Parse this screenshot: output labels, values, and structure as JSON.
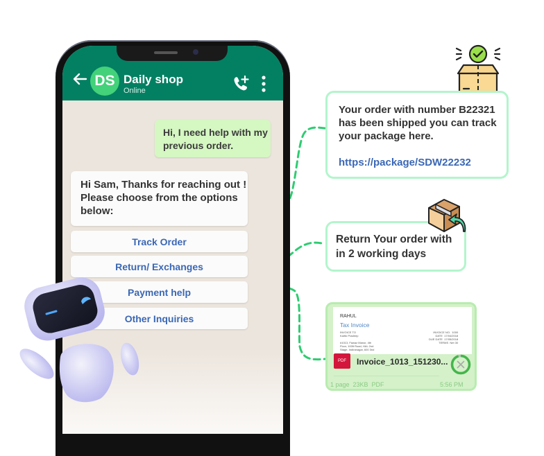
{
  "chat": {
    "contact_initials": "DS",
    "contact_name": "Daily shop",
    "contact_status": "Online",
    "icons": {
      "back": "arrow-left-icon",
      "call": "add-call-icon",
      "menu": "more-vertical-icon"
    },
    "messages": [
      {
        "direction": "outgoing",
        "text": "Hi, I need help with my previous order."
      },
      {
        "direction": "incoming",
        "text": "Hi Sam, Thanks for reaching out ! Please choose from the options below:"
      }
    ],
    "options": [
      {
        "label": "Track Order"
      },
      {
        "label": "Return/ Exchanges"
      },
      {
        "label": "Payment help"
      },
      {
        "label": "Other Inquiries"
      }
    ]
  },
  "responses": {
    "track": {
      "icon": "package-shipped-icon",
      "text": "Your order with number B22321 has been shipped you can track your package here.",
      "link": "https://package/SDW22232"
    },
    "return": {
      "icon": "package-return-icon",
      "text": "Return Your order with in 2 working days"
    },
    "invoice": {
      "preview_name": "RAHUL",
      "preview_title": "Tax Invoice",
      "preview_left": "INVOICE TO\nKartik Pradeep\n\n#1013, Fawaz Manor, 4th\nFloor, 100ft Road, HAL 2nd\nStage, Indiranagar, 600 3nd",
      "preview_right": "INVOICE NO.  1000\nDATE  17/04/2018\nDUE DATE  17/05/2018\nTERMS  Net 30",
      "badge": "PDF",
      "file_name": "Invoice_1013_151230...",
      "meta": "1 page  23KB  PDF",
      "time": "5:56 PM",
      "progress_percent": 95
    }
  },
  "colors": {
    "header": "#038062",
    "avatar": "#43d17a",
    "link": "#3a67b5",
    "connector": "#2ecc71",
    "outgoing_bubble": "#d5f7c2",
    "card_border": "#b3f5cc"
  }
}
